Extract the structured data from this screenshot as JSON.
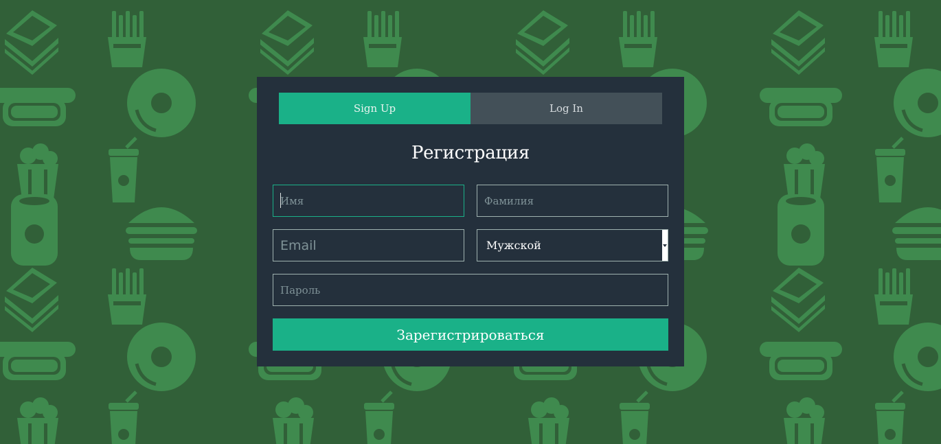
{
  "theme": {
    "background": "#316038",
    "pattern": "#3f8a4e",
    "panel": "#24303c",
    "accent": "#1ab188",
    "tab_inactive": "#435058"
  },
  "background_icons": [
    "sandwich-icon",
    "fries-icon",
    "hotdog-icon",
    "donut-icon",
    "popcorn-icon",
    "soda-cup-icon",
    "soda-can-icon",
    "burger-icon"
  ],
  "tabs": {
    "signup_label": "Sign Up",
    "login_label": "Log In",
    "active": "signup"
  },
  "form": {
    "title": "Регистрация",
    "first_name_placeholder": "Имя",
    "last_name_placeholder": "Фамилия",
    "email_placeholder": "Email",
    "gender_value": "Мужской",
    "password_placeholder": "Пароль",
    "submit_label": "Зарегистрироваться"
  }
}
